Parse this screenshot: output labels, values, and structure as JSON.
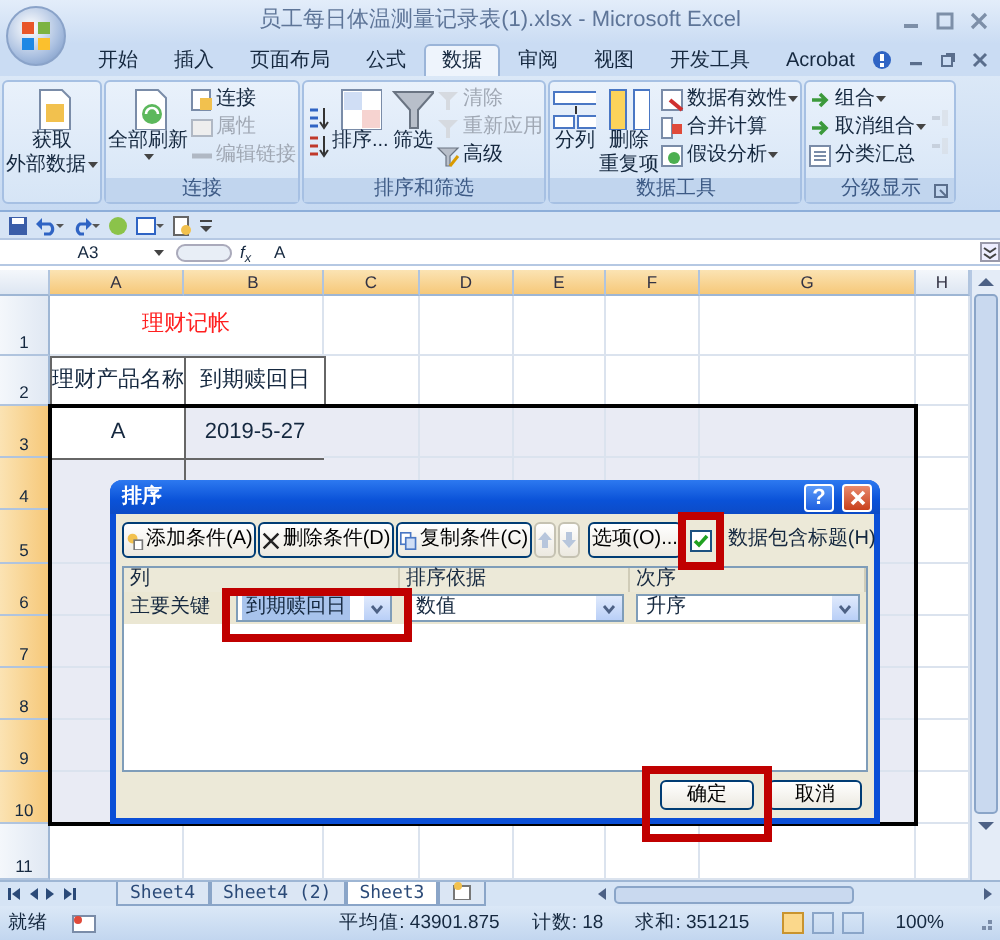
{
  "window": {
    "title": "员工每日体温测量记录表(1).xlsx - Microsoft Excel"
  },
  "ribbon_tabs": [
    {
      "label": "开始",
      "selected": false
    },
    {
      "label": "插入",
      "selected": false
    },
    {
      "label": "页面布局",
      "selected": false
    },
    {
      "label": "公式",
      "selected": false
    },
    {
      "label": "数据",
      "selected": true
    },
    {
      "label": "审阅",
      "selected": false
    },
    {
      "label": "视图",
      "selected": false
    },
    {
      "label": "开发工具",
      "selected": false
    },
    {
      "label": "Acrobat",
      "selected": false
    }
  ],
  "ribbon_groups": [
    {
      "items": [
        {
          "kind": "large",
          "lines": [
            "获取",
            "外部数据"
          ],
          "dropdown": true,
          "disabled": false
        }
      ]
    },
    {
      "label": "连接",
      "items": [
        {
          "kind": "large",
          "lines": [
            "全部刷新"
          ],
          "dropdown": true,
          "disabled": false
        },
        {
          "kind": "small",
          "lines": [
            "连接"
          ],
          "dropdown": false,
          "disabled": false
        },
        {
          "kind": "small",
          "lines": [
            "属性"
          ],
          "dropdown": false,
          "disabled": true
        },
        {
          "kind": "small",
          "lines": [
            "编辑链接"
          ],
          "dropdown": false,
          "disabled": true
        }
      ]
    },
    {
      "label": "排序和筛选",
      "items": [
        {
          "kind": "icon",
          "disabled": false
        },
        {
          "kind": "icon",
          "disabled": false
        },
        {
          "kind": "large",
          "lines": [
            "排序..."
          ],
          "dropdown": false,
          "disabled": false
        },
        {
          "kind": "large",
          "lines": [
            "筛选"
          ],
          "dropdown": false,
          "disabled": false
        },
        {
          "kind": "small",
          "lines": [
            "清除"
          ],
          "dropdown": false,
          "disabled": true
        },
        {
          "kind": "small",
          "lines": [
            "重新应用"
          ],
          "dropdown": false,
          "disabled": true
        },
        {
          "kind": "small",
          "lines": [
            "高级"
          ],
          "dropdown": false,
          "disabled": false
        }
      ]
    },
    {
      "label": "数据工具",
      "items": [
        {
          "kind": "large",
          "lines": [
            "分列"
          ],
          "dropdown": false,
          "disabled": false
        },
        {
          "kind": "large",
          "lines": [
            "删除",
            "重复项"
          ],
          "dropdown": false,
          "disabled": false
        },
        {
          "kind": "small",
          "lines": [
            "数据有效性"
          ],
          "dropdown": true,
          "disabled": false
        },
        {
          "kind": "small",
          "lines": [
            "合并计算"
          ],
          "dropdown": false,
          "disabled": false
        },
        {
          "kind": "small",
          "lines": [
            "假设分析"
          ],
          "dropdown": true,
          "disabled": false
        }
      ]
    },
    {
      "label": "分级显示",
      "items": [
        {
          "kind": "small",
          "lines": [
            "组合"
          ],
          "dropdown": true,
          "disabled": false
        },
        {
          "kind": "small",
          "lines": [
            "取消组合"
          ],
          "dropdown": true,
          "disabled": false
        },
        {
          "kind": "small",
          "lines": [
            "分类汇总"
          ],
          "dropdown": false,
          "disabled": false
        },
        {
          "kind": "icon",
          "disabled": true
        },
        {
          "kind": "icon",
          "disabled": true
        }
      ]
    }
  ],
  "formula_bar": {
    "name_box": "A3",
    "fx": "f$_{x}$",
    "content": "A"
  },
  "sheet": {
    "columns": [
      {
        "label": "A",
        "selected": true
      },
      {
        "label": "B",
        "selected": true
      },
      {
        "label": "C",
        "selected": true
      },
      {
        "label": "D",
        "selected": true
      },
      {
        "label": "E",
        "selected": true
      },
      {
        "label": "F",
        "selected": true
      },
      {
        "label": "G",
        "selected": true
      },
      {
        "label": "H",
        "selected": false
      }
    ],
    "rows": [
      {
        "label": "1",
        "selected": false,
        "kind": "title",
        "cells": [
          "理财记帐"
        ]
      },
      {
        "label": "2",
        "selected": false,
        "kind": "data",
        "cells": [
          "理财产品名称",
          "到期赎回日"
        ]
      },
      {
        "label": "3",
        "selected": true,
        "kind": "data",
        "cells": [
          "A",
          "2019-5-27"
        ]
      },
      {
        "label": "4",
        "selected": true,
        "kind": "bordered"
      },
      {
        "label": "5",
        "selected": true,
        "kind": "blank"
      },
      {
        "label": "6",
        "selected": true,
        "kind": "blank"
      },
      {
        "label": "7",
        "selected": true,
        "kind": "blank"
      },
      {
        "label": "8",
        "selected": true,
        "kind": "blank"
      },
      {
        "label": "9",
        "selected": true,
        "kind": "blank"
      },
      {
        "label": "10",
        "selected": true,
        "kind": "blank"
      },
      {
        "label": "11",
        "selected": false,
        "kind": "blank"
      }
    ]
  },
  "dialog": {
    "title": "排序",
    "help": "?",
    "toolbar": [
      {
        "kind": "button",
        "label": "添加条件(A)",
        "disabled": false
      },
      {
        "kind": "button",
        "label": "删除条件(D)",
        "disabled": false
      },
      {
        "kind": "button",
        "label": "复制条件(C)",
        "disabled": false
      },
      {
        "kind": "up",
        "disabled": true
      },
      {
        "kind": "down",
        "disabled": true
      },
      {
        "kind": "button",
        "label": "选项(O)...",
        "disabled": false
      }
    ],
    "header_checkbox": {
      "label": "数据包含标题(H)",
      "checked": true,
      "highlighted": true
    },
    "columns": [
      "列",
      "排序依据",
      "次序"
    ],
    "levels": [
      {
        "label": "主要关键",
        "fields": [
          {
            "value": "到期赎回日",
            "focused": true,
            "highlighted": true
          },
          {
            "value": "数值",
            "focused": false,
            "highlighted": false
          },
          {
            "value": "升序",
            "focused": false,
            "highlighted": false
          }
        ]
      }
    ],
    "buttons": [
      {
        "label": "确定",
        "highlighted": true
      },
      {
        "label": "取消",
        "highlighted": false
      }
    ]
  },
  "sheet_tabs": [
    {
      "label": "Sheet4",
      "selected": false
    },
    {
      "label": "Sheet4 (2)",
      "selected": false
    },
    {
      "label": "Sheet3",
      "selected": true
    }
  ],
  "status_bar": {
    "ready": "就绪",
    "average": "平均值: 43901.875",
    "count": "计数: 18",
    "sum": "求和: 351215",
    "zoom": "100%",
    "views": [
      {
        "selected": true
      },
      {
        "selected": false
      },
      {
        "selected": false
      }
    ]
  }
}
